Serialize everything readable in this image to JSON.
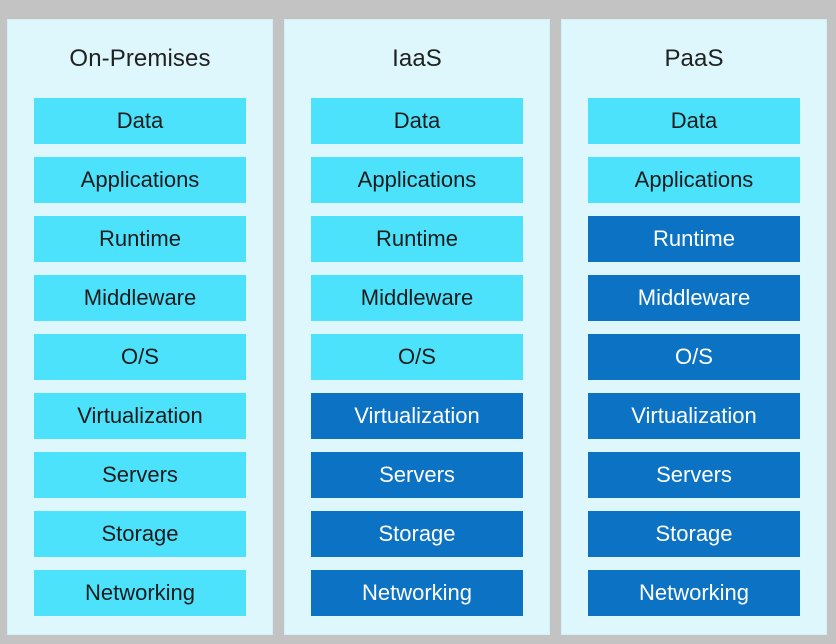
{
  "diagram": {
    "type": "responsibility-matrix",
    "legend": {
      "customer_managed_color": "#4ce2fc",
      "provider_managed_color": "#0c72c4",
      "panel_background_color": "#ddf7fc",
      "page_background_color": "#c3c3c3"
    },
    "columns": [
      {
        "title": "On-Premises",
        "layers": [
          {
            "label": "Data",
            "managed_by": "customer"
          },
          {
            "label": "Applications",
            "managed_by": "customer"
          },
          {
            "label": "Runtime",
            "managed_by": "customer"
          },
          {
            "label": "Middleware",
            "managed_by": "customer"
          },
          {
            "label": "O/S",
            "managed_by": "customer"
          },
          {
            "label": "Virtualization",
            "managed_by": "customer"
          },
          {
            "label": "Servers",
            "managed_by": "customer"
          },
          {
            "label": "Storage",
            "managed_by": "customer"
          },
          {
            "label": "Networking",
            "managed_by": "customer"
          }
        ]
      },
      {
        "title": "IaaS",
        "layers": [
          {
            "label": "Data",
            "managed_by": "customer"
          },
          {
            "label": "Applications",
            "managed_by": "customer"
          },
          {
            "label": "Runtime",
            "managed_by": "customer"
          },
          {
            "label": "Middleware",
            "managed_by": "customer"
          },
          {
            "label": "O/S",
            "managed_by": "customer"
          },
          {
            "label": "Virtualization",
            "managed_by": "provider"
          },
          {
            "label": "Servers",
            "managed_by": "provider"
          },
          {
            "label": "Storage",
            "managed_by": "provider"
          },
          {
            "label": "Networking",
            "managed_by": "provider"
          }
        ]
      },
      {
        "title": "PaaS",
        "layers": [
          {
            "label": "Data",
            "managed_by": "customer"
          },
          {
            "label": "Applications",
            "managed_by": "customer"
          },
          {
            "label": "Runtime",
            "managed_by": "provider"
          },
          {
            "label": "Middleware",
            "managed_by": "provider"
          },
          {
            "label": "O/S",
            "managed_by": "provider"
          },
          {
            "label": "Virtualization",
            "managed_by": "provider"
          },
          {
            "label": "Servers",
            "managed_by": "provider"
          },
          {
            "label": "Storage",
            "managed_by": "provider"
          },
          {
            "label": "Networking",
            "managed_by": "provider"
          }
        ]
      }
    ]
  }
}
